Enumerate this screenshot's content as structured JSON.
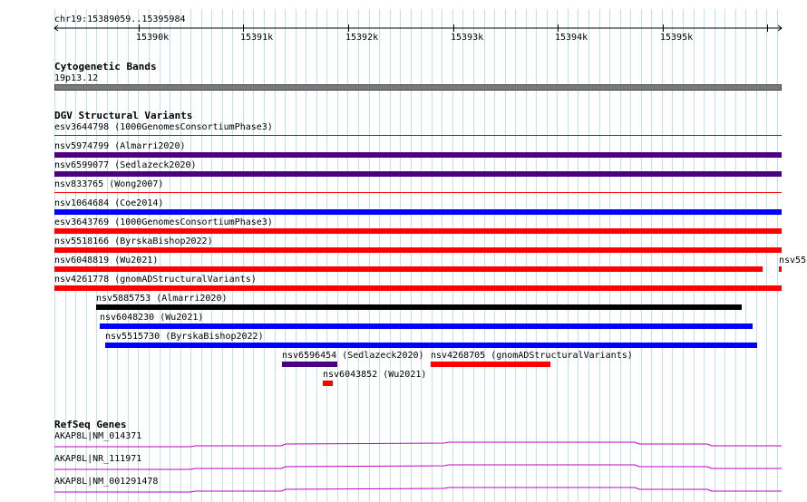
{
  "ruler": {
    "location": "chr19:15389059..15395984",
    "ticks": [
      "15390k",
      "15391k",
      "15392k",
      "15393k",
      "15394k",
      "15395k"
    ]
  },
  "tracks": {
    "cytoband": {
      "title": "Cytogenetic Bands",
      "band_label": "19p13.12",
      "band_color": "#7a7a7a"
    },
    "dgv": {
      "title": "DGV Structural Variants",
      "features": [
        {
          "label": "esv3644798 (1000GenomesConsortiumPhase3)",
          "color": "#ff0000"
        },
        {
          "label": "nsv5974799 (Almarri2020)",
          "color": "#4b0082"
        },
        {
          "label": "nsv6599077 (Sedlazeck2020)",
          "color": "#4b0082"
        },
        {
          "label": "nsv833765 (Wong2007)",
          "color": "#ff0000"
        },
        {
          "label": "nsv1064684 (Coe2014)",
          "color": "#0000ff"
        },
        {
          "label": "esv3643769 (1000GenomesConsortiumPhase3)",
          "color": "#ff0000"
        },
        {
          "label": "nsv5518166 (ByrskaBishop2022)",
          "color": "#ff0000"
        },
        {
          "label": "nsv6048819 (Wu2021)",
          "color": "#ff0000"
        },
        {
          "label": "nsv55",
          "color": "#ff0000"
        },
        {
          "label": "nsv4261778 (gnomADStructuralVariants)",
          "color": "#ff0000"
        },
        {
          "label": "nsv5885753 (Almarri2020)",
          "color": "#000000"
        },
        {
          "label": "nsv6048230 (Wu2021)",
          "color": "#0000ff"
        },
        {
          "label": "nsv5515730 (ByrskaBishop2022)",
          "color": "#0000ff"
        },
        {
          "label": "nsv6596454 (Sedlazeck2020)",
          "color": "#4b0082"
        },
        {
          "label": "nsv4268705 (gnomADStructuralVariants)",
          "color": "#ff0000"
        },
        {
          "label": "nsv6043852 (Wu2021)",
          "color": "#ff0000"
        }
      ]
    },
    "refseq": {
      "title": "RefSeq Genes",
      "transcripts": [
        "AKAP8L|NM_014371",
        "AKAP8L|NR_111971",
        "AKAP8L|NM_001291478"
      ],
      "color": "#c000c0"
    }
  }
}
